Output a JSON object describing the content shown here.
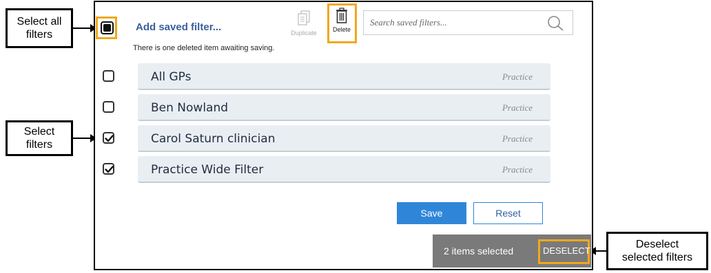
{
  "callouts": {
    "select_all": "Select all\nfilters",
    "select_filters": "Select\nfilters",
    "deselect": "Deselect\nselected filters"
  },
  "header": {
    "add_saved_filter": "Add saved filter...",
    "notice": "There is one deleted item awaiting saving."
  },
  "toolbar": {
    "duplicate_label": "Duplicate",
    "delete_label": "Delete"
  },
  "search": {
    "placeholder": "Search saved filters..."
  },
  "filters": [
    {
      "name": "All GPs",
      "scope": "Practice",
      "checked": false
    },
    {
      "name": "Ben Nowland",
      "scope": "Practice",
      "checked": false
    },
    {
      "name": "Carol Saturn clinician",
      "scope": "Practice",
      "checked": true
    },
    {
      "name": "Practice Wide Filter",
      "scope": "Practice",
      "checked": true
    }
  ],
  "actions": {
    "save_label": "Save",
    "reset_label": "Reset"
  },
  "snackbar": {
    "text": "2 items selected",
    "deselect_label": "DESELECT"
  },
  "colors": {
    "highlight": "#f0a81a",
    "primary": "#2f86d8",
    "snackbar": "#7a7a7a",
    "card": "#e9eef3"
  }
}
